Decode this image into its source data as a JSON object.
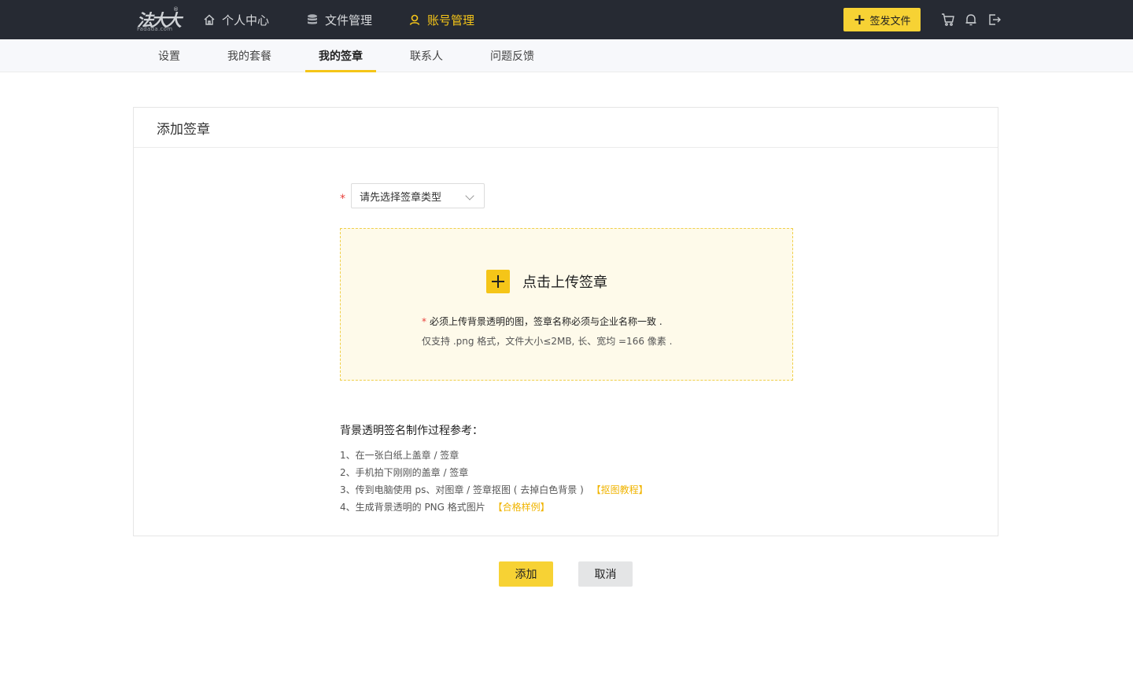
{
  "brand": {
    "logo_main": "法大大",
    "logo_sub": "Fadada.com",
    "logo_reg": "®",
    "accent_color": "#f5c518"
  },
  "topnav": {
    "items": [
      {
        "label": "个人中心",
        "icon": "home-icon",
        "active": false
      },
      {
        "label": "文件管理",
        "icon": "database-icon",
        "active": false
      },
      {
        "label": "账号管理",
        "icon": "user-icon",
        "active": true
      }
    ],
    "publish_label": "签发文件",
    "icons": [
      "cart-icon",
      "bell-icon",
      "logout-icon"
    ]
  },
  "subnav": {
    "items": [
      {
        "label": "设置",
        "active": false
      },
      {
        "label": "我的套餐",
        "active": false
      },
      {
        "label": "我的签章",
        "active": true
      },
      {
        "label": "联系人",
        "active": false
      },
      {
        "label": "问题反馈",
        "active": false
      }
    ]
  },
  "card": {
    "title": "添加签章",
    "select_placeholder": "请先选择签章类型",
    "required_mark": "*",
    "upload": {
      "label": "点击上传签章",
      "note_star": "*",
      "note1": "必须上传背景透明的图，签章名称必须与企业名称一致 .",
      "note2": "仅支持 .png 格式，文件大小≤2MB, 长、宽均 =166 像素 ."
    },
    "guide": {
      "title": "背景透明签名制作过程参考：",
      "steps": [
        "1、在一张白纸上盖章 / 签章",
        "2、手机拍下刚刚的盖章 / 签章",
        "3、传到电脑使用 ps、对图章 / 签章抠图 ( 去掉白色背景 )",
        "4、生成背景透明的 PNG 格式图片"
      ],
      "link_tutorial": "【抠图教程】",
      "link_sample": "【合格样例】"
    }
  },
  "actions": {
    "add_label": "添加",
    "cancel_label": "取消"
  }
}
